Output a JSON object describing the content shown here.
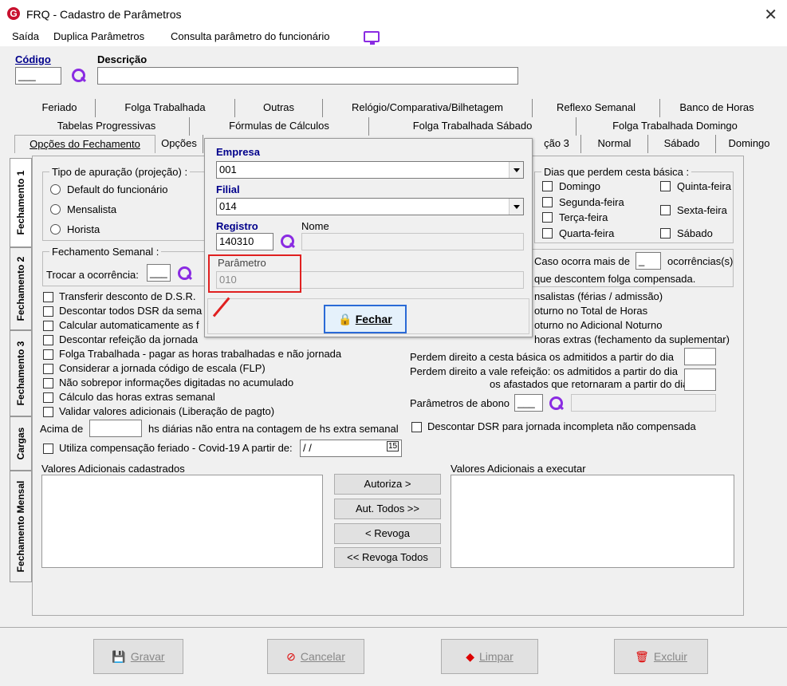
{
  "window": {
    "title": "FRQ - Cadastro de Parâmetros",
    "close": "✕"
  },
  "menu": {
    "items": [
      "Saída",
      "Duplica Parâmetros",
      "Consulta parâmetro do funcionário"
    ]
  },
  "header": {
    "codigo_label": "Código",
    "codigo_value": "___",
    "descricao_label": "Descrição",
    "descricao_value": ""
  },
  "tabs": {
    "row1": [
      "Feriado",
      "Folga Trabalhada",
      "Outras",
      "Relógio/Comparativa/Bilhetagem",
      "Reflexo Semanal",
      "Banco de Horas"
    ],
    "row2": [
      "Tabelas Progressivas",
      "Fórmulas de Cálculos",
      "Folga Trabalhada Sábado",
      "Folga Trabalhada Domingo"
    ],
    "row3": [
      "Opções do Fechamento",
      "Opções",
      "",
      "Normal",
      "Sábado",
      "Domingo"
    ],
    "row3_partial": "ção 3"
  },
  "vtabs": [
    "Fechamento 1",
    "Fechamento 2",
    "Fechamento 3",
    "Cargas",
    "Fechamento Mensal"
  ],
  "apuracao": {
    "title": "Tipo de apuração (projeção) :",
    "options": [
      "Default do funcionário",
      "Mensalista",
      "Horista"
    ]
  },
  "semanal": {
    "title": "Fechamento Semanal :",
    "trocar_label": "Trocar a ocorrência:",
    "trocar_value": "___"
  },
  "cesta": {
    "title": "Dias que perdem cesta básica :",
    "days_left": [
      "Domingo",
      "Segunda-feira",
      "Terça-feira",
      "Quarta-feira"
    ],
    "days_right": [
      "Quinta-feira",
      "Sexta-feira",
      "Sábado"
    ]
  },
  "ocorre": {
    "prefix": "Caso ocorra mais de",
    "value": "_",
    "suffix": "ocorrências(s)",
    "line2": "que descontem folga compensada."
  },
  "right_partial": [
    "nsalistas (férias / admissão)",
    "oturno no Total de Horas",
    "oturno no Adicional Noturno",
    "horas extras (fechamento da suplementar)"
  ],
  "checks": [
    "Transferir desconto de D.S.R.",
    "Descontar todos DSR da sema",
    "Calcular automaticamente as f",
    "Descontar refeição da jornada",
    "Folga Trabalhada - pagar as horas trabalhadas e não jornada",
    "Considerar a jornada código de escala (FLP)",
    "Não sobrepor informações digitadas no acumulado",
    "Cálculo das horas extras semanal",
    "Validar valores adicionais (Liberação de pagto)"
  ],
  "acima": {
    "prefix": "Acima de",
    "suffix": "hs diárias não entra na contagem de hs extra semanal"
  },
  "covid": {
    "label": "Utiliza compensação feriado - Covid-19  A partir de:",
    "date": " /  /",
    "cal": "15"
  },
  "perdem": {
    "cesta": "Perdem direito a cesta básica os admitidos a partir do dia",
    "vale1": "Perdem direito a vale refeição: os admitidos a partir do dia",
    "vale2": "os afastados que retornaram a partir do dia",
    "abono": "Parâmetros de abono",
    "abono_value": "___"
  },
  "dsr_incompleta": "Descontar DSR para jornada incompleta não compensada",
  "valores": {
    "cadastrados": "Valores Adicionais cadastrados",
    "executar": "Valores Adicionais a executar",
    "buttons": [
      "Autoriza >",
      "Aut. Todos >>",
      "< Revoga",
      "<< Revoga Todos"
    ]
  },
  "popup": {
    "empresa_label": "Empresa",
    "empresa_value": "001",
    "filial_label": "Filial",
    "filial_value": "014",
    "registro_label": "Registro",
    "registro_value": "140310",
    "nome_label": "Nome",
    "parametro_label": "Parâmetro",
    "parametro_value": "010",
    "fechar": "Fechar"
  },
  "footer": {
    "gravar": "Gravar",
    "cancelar": "Cancelar",
    "limpar": "Limpar",
    "excluir": "Excluir"
  },
  "colors": {
    "accent": "#00008b",
    "icon": "#8a2be2",
    "highlight": "#e02020"
  }
}
